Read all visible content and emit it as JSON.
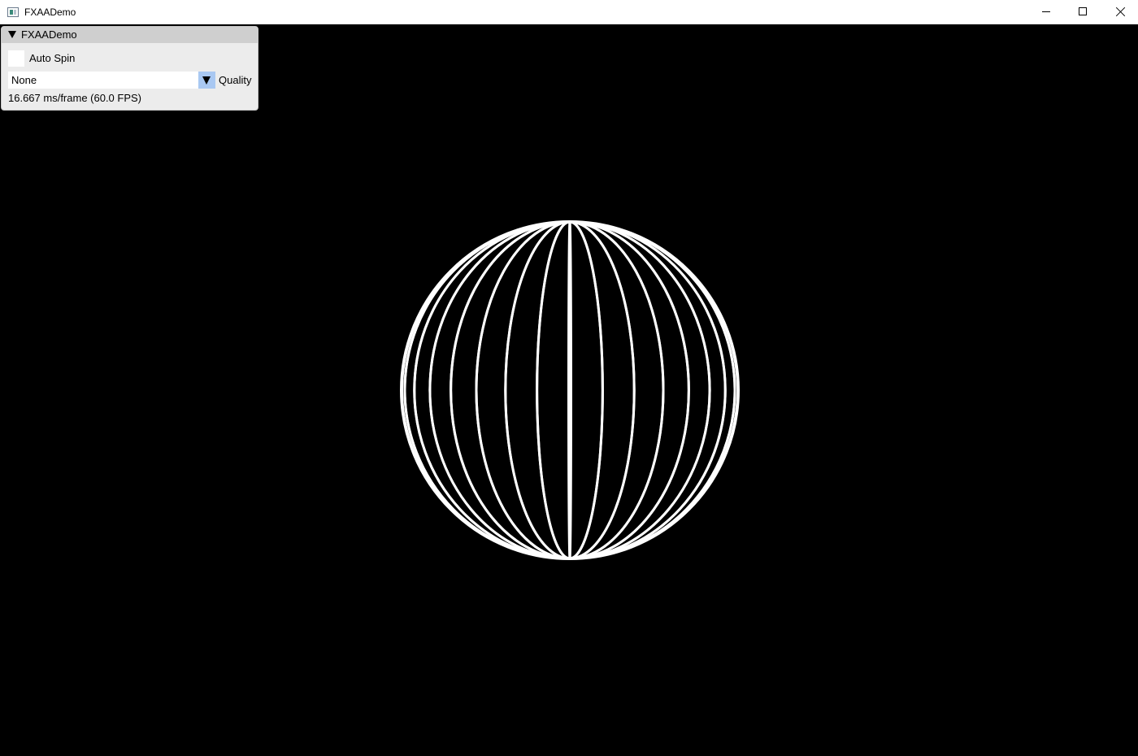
{
  "window": {
    "title": "FXAADemo",
    "icon": "app-window-icon",
    "controls": [
      "minimize-icon",
      "maximize-icon",
      "close-icon"
    ]
  },
  "panel": {
    "title": "FXAADemo",
    "auto_spin": {
      "label": "Auto Spin",
      "checked": false
    },
    "quality": {
      "label": "Quality",
      "selected": "None"
    },
    "stats": "16.667 ms/frame (60.0 FPS)"
  },
  "colors": {
    "background": "#000000",
    "wireframe": "#ffffff",
    "panel_bg": "#ececec",
    "panel_header": "#cfcfcf",
    "combo_arrow": "#a9c8f2"
  }
}
